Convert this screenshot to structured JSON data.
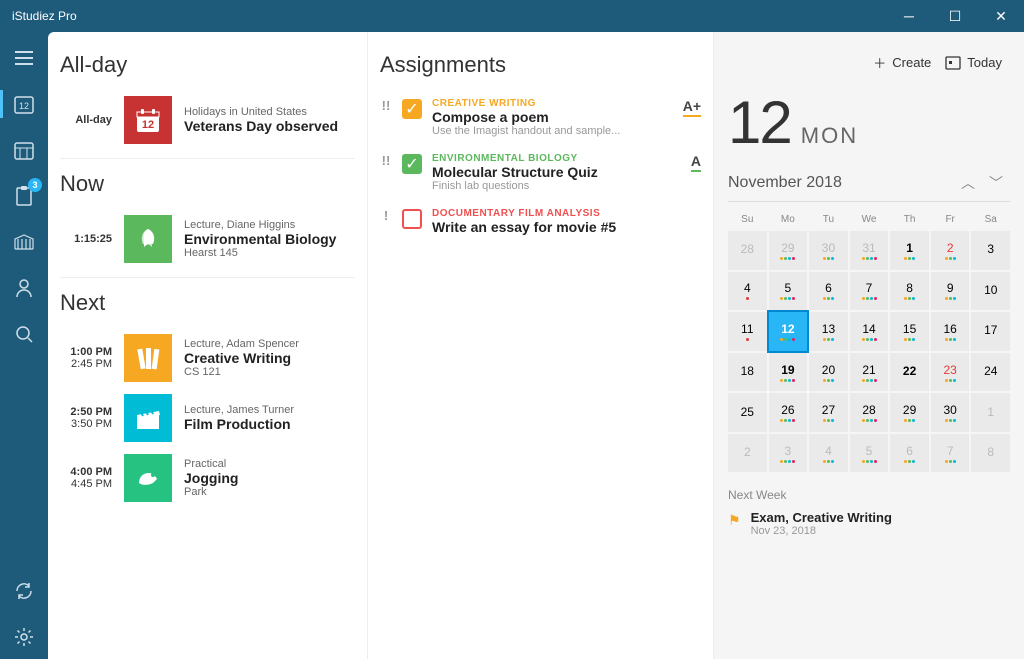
{
  "window": {
    "title": "iStudiez Pro"
  },
  "toolbar": {
    "create": "Create",
    "today": "Today"
  },
  "sidebar": {
    "badge": "3"
  },
  "allday": {
    "header": "All-day",
    "label": "All-day",
    "event": {
      "subtitle": "Holidays in United States",
      "title": "Veterans Day observed",
      "iconDay": "12",
      "color": "#c73232"
    }
  },
  "now": {
    "header": "Now",
    "event": {
      "time": "1:15:25",
      "subtitle": "Lecture, Diane Higgins",
      "title": "Environmental Biology",
      "loc": "Hearst 145",
      "color": "#5cb85c"
    }
  },
  "next": {
    "header": "Next",
    "events": [
      {
        "t1": "1:00 PM",
        "t2": "2:45 PM",
        "subtitle": "Lecture, Adam Spencer",
        "title": "Creative Writing",
        "loc": "CS 121",
        "color": "#f7a823",
        "icon": "books"
      },
      {
        "t1": "2:50 PM",
        "t2": "3:50 PM",
        "subtitle": "Lecture, James Turner",
        "title": "Film Production",
        "loc": "",
        "color": "#00bcd4",
        "icon": "clapper"
      },
      {
        "t1": "4:00 PM",
        "t2": "4:45 PM",
        "subtitle": "Practical",
        "title": "Jogging",
        "loc": "Park",
        "color": "#26c281",
        "icon": "shoe"
      }
    ]
  },
  "assignments": {
    "header": "Assignments",
    "items": [
      {
        "pri": "!!",
        "chk": "done",
        "course": "CREATIVE WRITING",
        "courseColor": "#f7a823",
        "title": "Compose a poem",
        "sub": "Use the Imagist handout and sample...",
        "grade": "A+",
        "gradeColor": "#f7a823"
      },
      {
        "pri": "!!",
        "chk": "green",
        "course": "ENVIRONMENTAL BIOLOGY",
        "courseColor": "#5cb85c",
        "title": "Molecular Structure Quiz",
        "sub": "Finish lab questions",
        "grade": "A",
        "gradeColor": "#5cb85c"
      },
      {
        "pri": "!",
        "chk": "red",
        "course": "DOCUMENTARY FILM ANALYSIS",
        "courseColor": "#f05050",
        "title": "Write an essay for movie #5",
        "sub": "",
        "grade": "",
        "gradeColor": ""
      }
    ]
  },
  "calendar": {
    "bigNum": "12",
    "bigDay": "MON",
    "monthLabel": "November 2018",
    "dow": [
      "Su",
      "Mo",
      "Tu",
      "We",
      "Th",
      "Fr",
      "Sa"
    ],
    "cells": [
      {
        "n": "28",
        "dim": true,
        "dots": []
      },
      {
        "n": "29",
        "dim": true,
        "dots": [
          "#f7a823",
          "#5cb85c",
          "#00bcd4",
          "#e91e63"
        ]
      },
      {
        "n": "30",
        "dim": true,
        "dots": [
          "#f7a823",
          "#5cb85c",
          "#00bcd4"
        ]
      },
      {
        "n": "31",
        "dim": true,
        "dots": [
          "#f7a823",
          "#5cb85c",
          "#00bcd4",
          "#e91e63"
        ]
      },
      {
        "n": "1",
        "bold": true,
        "dots": [
          "#f7a823",
          "#5cb85c",
          "#00bcd4"
        ]
      },
      {
        "n": "2",
        "red": true,
        "dots": [
          "#f7a823",
          "#5cb85c",
          "#00bcd4"
        ]
      },
      {
        "n": "3",
        "dots": []
      },
      {
        "n": "4",
        "dots": [
          "#e53935"
        ]
      },
      {
        "n": "5",
        "dots": [
          "#f7a823",
          "#5cb85c",
          "#00bcd4",
          "#e91e63"
        ]
      },
      {
        "n": "6",
        "dots": [
          "#f7a823",
          "#5cb85c",
          "#00bcd4"
        ]
      },
      {
        "n": "7",
        "dots": [
          "#f7a823",
          "#5cb85c",
          "#00bcd4",
          "#e91e63"
        ]
      },
      {
        "n": "8",
        "dots": [
          "#f7a823",
          "#5cb85c",
          "#00bcd4"
        ]
      },
      {
        "n": "9",
        "dots": [
          "#f7a823",
          "#5cb85c",
          "#00bcd4"
        ]
      },
      {
        "n": "10",
        "dots": []
      },
      {
        "n": "11",
        "dots": [
          "#e53935"
        ]
      },
      {
        "n": "12",
        "sel": true,
        "bold": true,
        "dots": [
          "#f7a823",
          "#5cb85c",
          "#00bcd4",
          "#e91e63"
        ]
      },
      {
        "n": "13",
        "dots": [
          "#f7a823",
          "#5cb85c",
          "#00bcd4"
        ]
      },
      {
        "n": "14",
        "dots": [
          "#f7a823",
          "#5cb85c",
          "#00bcd4",
          "#e91e63"
        ]
      },
      {
        "n": "15",
        "dots": [
          "#f7a823",
          "#5cb85c",
          "#00bcd4"
        ]
      },
      {
        "n": "16",
        "dots": [
          "#f7a823",
          "#5cb85c",
          "#00bcd4"
        ]
      },
      {
        "n": "17",
        "dots": []
      },
      {
        "n": "18",
        "dots": []
      },
      {
        "n": "19",
        "bold": true,
        "dots": [
          "#f7a823",
          "#5cb85c",
          "#00bcd4",
          "#e91e63"
        ]
      },
      {
        "n": "20",
        "dots": [
          "#f7a823",
          "#5cb85c",
          "#00bcd4"
        ]
      },
      {
        "n": "21",
        "dots": [
          "#f7a823",
          "#5cb85c",
          "#00bcd4",
          "#e91e63"
        ]
      },
      {
        "n": "22",
        "bold": true,
        "dots": []
      },
      {
        "n": "23",
        "red": true,
        "dots": [
          "#f7a823",
          "#5cb85c",
          "#00bcd4"
        ]
      },
      {
        "n": "24",
        "dots": []
      },
      {
        "n": "25",
        "dots": []
      },
      {
        "n": "26",
        "dots": [
          "#f7a823",
          "#5cb85c",
          "#00bcd4",
          "#e91e63"
        ]
      },
      {
        "n": "27",
        "dots": [
          "#f7a823",
          "#5cb85c",
          "#00bcd4"
        ]
      },
      {
        "n": "28",
        "dots": [
          "#f7a823",
          "#5cb85c",
          "#00bcd4",
          "#e91e63"
        ]
      },
      {
        "n": "29",
        "dots": [
          "#f7a823",
          "#5cb85c",
          "#00bcd4"
        ]
      },
      {
        "n": "30",
        "dots": [
          "#f7a823",
          "#5cb85c",
          "#00bcd4"
        ]
      },
      {
        "n": "1",
        "dim": true,
        "dots": []
      },
      {
        "n": "2",
        "dim": true,
        "dots": []
      },
      {
        "n": "3",
        "dim": true,
        "dots": [
          "#f7a823",
          "#5cb85c",
          "#00bcd4",
          "#e91e63"
        ]
      },
      {
        "n": "4",
        "dim": true,
        "dots": [
          "#f7a823",
          "#5cb85c",
          "#00bcd4"
        ]
      },
      {
        "n": "5",
        "dim": true,
        "dots": [
          "#f7a823",
          "#5cb85c",
          "#00bcd4",
          "#e91e63"
        ]
      },
      {
        "n": "6",
        "dim": true,
        "dots": [
          "#f7a823",
          "#5cb85c",
          "#00bcd4"
        ]
      },
      {
        "n": "7",
        "dim": true,
        "dots": [
          "#f7a823",
          "#5cb85c",
          "#00bcd4"
        ]
      },
      {
        "n": "8",
        "dim": true,
        "dots": []
      }
    ],
    "nextWeek": {
      "label": "Next Week",
      "title": "Exam, Creative Writing",
      "sub": "Nov 23, 2018"
    }
  }
}
